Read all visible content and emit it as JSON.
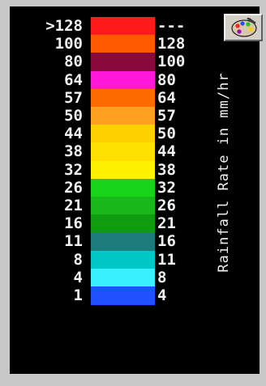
{
  "legend": {
    "title": "Rainfall Rate in mm/hr",
    "left_labels": [
      ">128",
      "100",
      "80",
      "64",
      "57",
      "50",
      "44",
      "38",
      "32",
      "26",
      "21",
      "16",
      "11",
      "8",
      "4",
      "1"
    ],
    "right_labels": [
      "---",
      "128",
      "100",
      "80",
      "64",
      "57",
      "50",
      "44",
      "38",
      "32",
      "26",
      "21",
      "16",
      "11",
      "8",
      "4"
    ],
    "colors": [
      "#ff1a1a",
      "#ff5a00",
      "#8b0a3c",
      "#ff18d8",
      "#ff6a00",
      "#ffa020",
      "#ffd000",
      "#ffe000",
      "#fff200",
      "#19d319",
      "#18b818",
      "#0f9c0f",
      "#1c7c7c",
      "#00c8c8",
      "#38f0ff",
      "#2050ff"
    ]
  },
  "toolbar": {
    "palette_icon": "palette-icon"
  }
}
